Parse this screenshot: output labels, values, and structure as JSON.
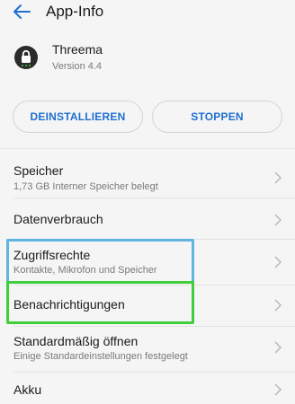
{
  "header": {
    "title": "App-Info",
    "back_icon": "arrow-left-icon",
    "accent": "#1e6fd1"
  },
  "app": {
    "name": "Threema",
    "version": "Version 4.4",
    "icon": "threema-lock-icon"
  },
  "actions": {
    "uninstall_label": "DEINSTALLIEREN",
    "stop_label": "STOPPEN"
  },
  "settings": {
    "items": [
      {
        "title": "Speicher",
        "subtitle": "1,73 GB Interner Speicher belegt"
      },
      {
        "title": "Datenverbrauch",
        "subtitle": ""
      },
      {
        "title": "Zugriffsrechte",
        "subtitle": "Kontakte, Mikrofon und Speicher"
      },
      {
        "title": "Benachrichtigungen",
        "subtitle": ""
      },
      {
        "title": "Standardmäßig öffnen",
        "subtitle": "Einige Standardeinstellungen festgelegt"
      },
      {
        "title": "Akku",
        "subtitle": ""
      }
    ]
  },
  "highlight_colors": {
    "blue": "#5fb4e0",
    "green": "#3fcf3a"
  }
}
